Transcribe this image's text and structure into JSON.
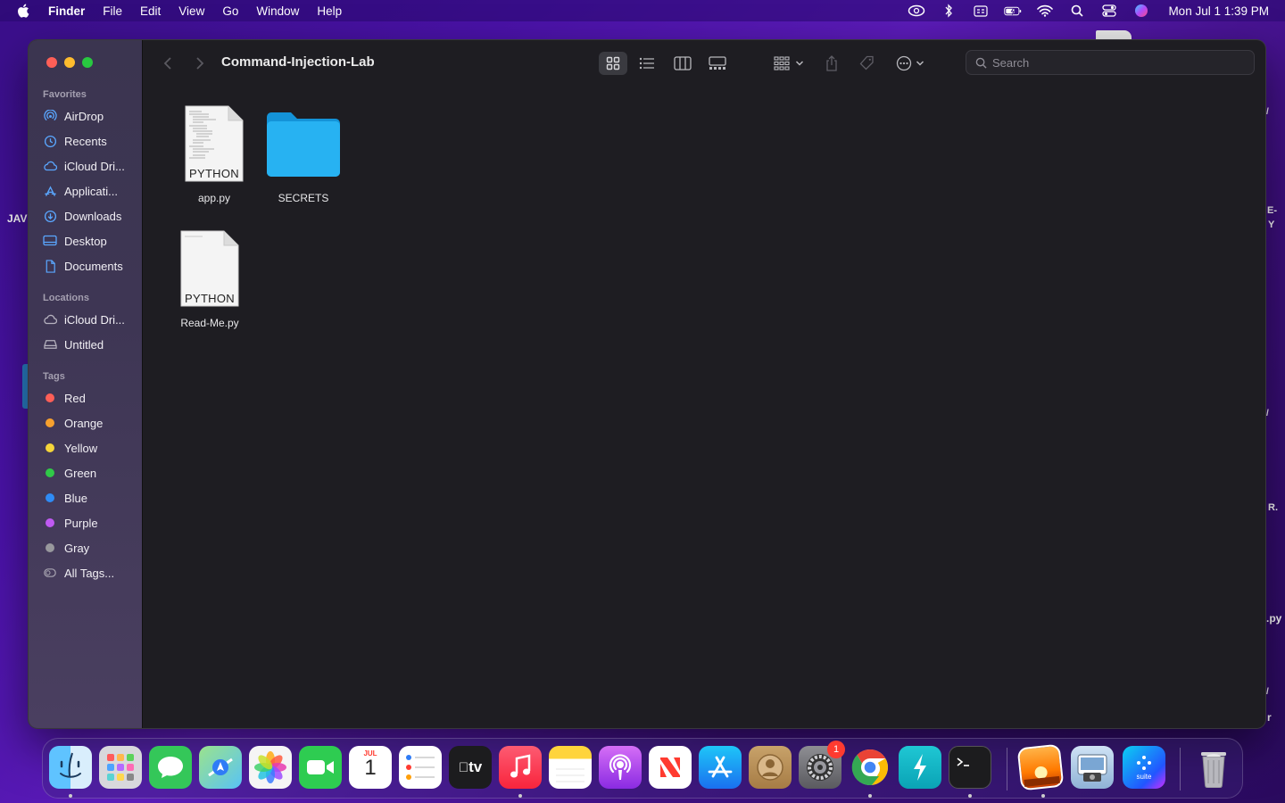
{
  "menubar": {
    "app_name": "Finder",
    "items": [
      "File",
      "Edit",
      "View",
      "Go",
      "Window",
      "Help"
    ],
    "clock": "Mon Jul 1  1:39 PM",
    "status_icons": [
      "creative-cloud-icon",
      "bluetooth-icon",
      "keyboard-input-icon",
      "battery-icon",
      "wifi-icon",
      "spotlight-icon",
      "control-center-icon",
      "siri-icon"
    ]
  },
  "desktop": {
    "fragments": [
      "JAV",
      "E-",
      "Y",
      "R.",
      ".py",
      "r",
      "/",
      "/",
      "/"
    ]
  },
  "window": {
    "title": "Command-Injection-Lab",
    "search_placeholder": "Search",
    "sidebar": {
      "favorites_header": "Favorites",
      "favorites": [
        {
          "label": "AirDrop",
          "icon": "airdrop-icon"
        },
        {
          "label": "Recents",
          "icon": "clock-icon"
        },
        {
          "label": "iCloud Dri...",
          "icon": "cloud-icon"
        },
        {
          "label": "Applicati...",
          "icon": "applications-icon"
        },
        {
          "label": "Downloads",
          "icon": "download-icon"
        },
        {
          "label": "Desktop",
          "icon": "desktop-icon"
        },
        {
          "label": "Documents",
          "icon": "document-icon"
        }
      ],
      "locations_header": "Locations",
      "locations": [
        {
          "label": "iCloud Dri...",
          "icon": "cloud-icon"
        },
        {
          "label": "Untitled",
          "icon": "disk-icon"
        }
      ],
      "tags_header": "Tags",
      "tags": [
        {
          "label": "Red",
          "color": "#fe5f57"
        },
        {
          "label": "Orange",
          "color": "#f7a02e"
        },
        {
          "label": "Yellow",
          "color": "#f5d53a"
        },
        {
          "label": "Green",
          "color": "#30c948"
        },
        {
          "label": "Blue",
          "color": "#2f8bf5"
        },
        {
          "label": "Purple",
          "color": "#bf5af2"
        },
        {
          "label": "Gray",
          "color": "#98989d"
        }
      ],
      "all_tags": "All Tags..."
    },
    "files": [
      {
        "name": "app.py",
        "kind": "PYTHON"
      },
      {
        "name": "SECRETS",
        "kind": "folder"
      },
      {
        "name": "Read-Me.py",
        "kind": "PYTHON"
      }
    ]
  },
  "dock": {
    "apps": [
      "Finder",
      "Launchpad",
      "Messages",
      "Maps",
      "Photos",
      "FaceTime",
      "Calendar",
      "Reminders",
      "Apple TV",
      "Music",
      "Notes",
      "Podcasts",
      "News",
      "App Store",
      "Contacts",
      "System Settings",
      "Chrome",
      "Cursor",
      "Terminal",
      "Preview",
      "Screenshot",
      "Suite",
      "Trash"
    ],
    "calendar_month": "JUL",
    "calendar_day": "1",
    "tv_label": "tv",
    "suite_label": "suite",
    "settings_badge": "1"
  },
  "colors": {
    "accent": "#1a9ff0",
    "window_bg": "#1e1d22",
    "sidebar_bg": "#3e3654"
  }
}
